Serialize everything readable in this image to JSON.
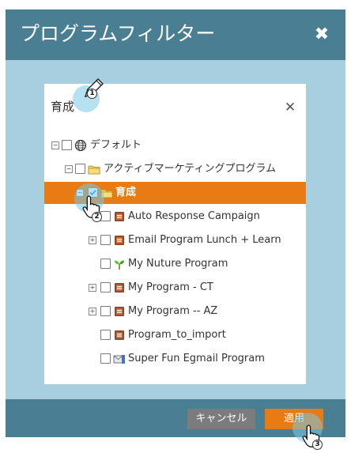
{
  "modal": {
    "title": "プログラムフィルター",
    "close_symbol": "✖",
    "panel": {
      "title": "育成",
      "close_symbol": "✕"
    },
    "tree": [
      {
        "label": "デフォルト",
        "icon": "globe-icon",
        "checked": false,
        "expander": "⊟"
      },
      {
        "label": "アクティブマーケティングプログラム",
        "icon": "folder-icon",
        "checked": false,
        "expander": "⊟"
      },
      {
        "label": "育成",
        "icon": "folder-icon",
        "checked": true,
        "expander": "⊟",
        "selected": true
      },
      {
        "label": "Auto Response Campaign",
        "icon": "program-icon",
        "checked": false
      },
      {
        "label": "Email Program Lunch + Learn",
        "icon": "program-icon",
        "checked": false,
        "expander": "⊞"
      },
      {
        "label": "My Nuture Program",
        "icon": "nurture-icon",
        "checked": false
      },
      {
        "label": "My Program - CT",
        "icon": "program-icon",
        "checked": false,
        "expander": "⊞"
      },
      {
        "label": "My Program -- AZ",
        "icon": "program-icon",
        "checked": false,
        "expander": "⊞"
      },
      {
        "label": "Program_to_import",
        "icon": "program-icon",
        "checked": false
      },
      {
        "label": "Super Fun Egmail Program",
        "icon": "email-program-icon",
        "checked": false
      }
    ],
    "footer": {
      "cancel_label": "キャンセル",
      "apply_label": "適用"
    }
  },
  "steps": {
    "step1": "1",
    "step2": "2",
    "step3": "3"
  },
  "colors": {
    "header": "#4a7f93",
    "body": "#a7cfe0",
    "selected": "#e97b14",
    "cancel": "#7c7c7c",
    "apply": "#e97b14"
  }
}
